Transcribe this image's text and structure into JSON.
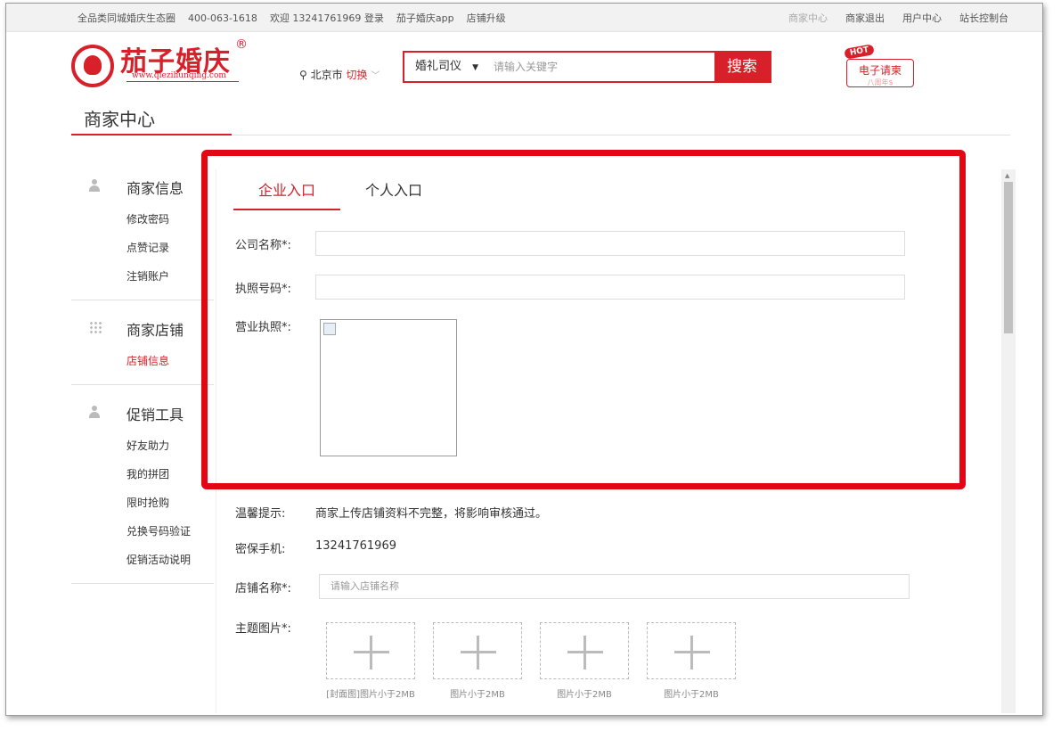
{
  "topbar": {
    "left": [
      "全品类同城婚庆生态圈",
      "400-063-1618",
      "欢迎 13241761969 登录",
      "茄子婚庆app",
      "店铺升级"
    ],
    "right": [
      "商家中心",
      "商家退出",
      "用户中心",
      "站长控制台"
    ]
  },
  "header": {
    "brand": "茄子婚庆",
    "brand_mark": "®",
    "url": "www.qiezihunqing.com",
    "city": "北京市",
    "city_switch": "切换",
    "search": {
      "category": "婚礼司仪",
      "placeholder": "请输入关键字",
      "button": "搜索"
    },
    "hot": {
      "tag": "HOT",
      "label": "电子请柬",
      "sub": "八周年$"
    }
  },
  "page_title": "商家中心",
  "sidebar": {
    "groups": [
      {
        "title": "商家信息",
        "icon": "person-icon",
        "items": [
          "修改密码",
          "点赞记录",
          "注销账户"
        ]
      },
      {
        "title": "商家店铺",
        "icon": "grid-icon",
        "items": [
          "店铺信息"
        ],
        "active": "店铺信息"
      },
      {
        "title": "促销工具",
        "icon": "person-icon",
        "items": [
          "好友助力",
          "我的拼团",
          "限时抢购",
          "兑换号码验证",
          "促销活动说明"
        ]
      }
    ]
  },
  "tabs": [
    "企业入口",
    "个人入口"
  ],
  "form": {
    "company_label": "公司名称",
    "license_no_label": "执照号码",
    "license_img_label": "营业执照",
    "required_mark": "*:",
    "tip_label": "温馨提示:",
    "tip_text": "商家上传店铺资料不完整，将影响审核通过。",
    "phone_label": "密保手机:",
    "phone_value": "13241761969",
    "shop_name_label": "店铺名称",
    "shop_name_placeholder": "请输入店铺名称",
    "theme_img_label": "主题图片",
    "theme_captions": [
      "[封面图]图片小于2MB",
      "图片小于2MB",
      "图片小于2MB",
      "图片小于2MB"
    ]
  },
  "colors": {
    "brand_red": "#d8202a",
    "highlight_red": "#e30613"
  }
}
